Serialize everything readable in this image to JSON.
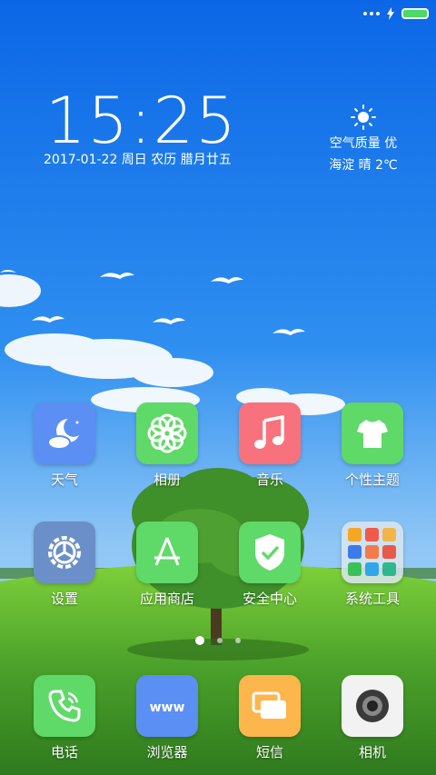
{
  "status_bar": {
    "battery_level": 1.0,
    "battery_color": "#4cd964"
  },
  "lockscreen": {
    "time": "15:25",
    "date": "2017-01-22 周日 农历 腊月廿五",
    "weather": {
      "icon": "sun-icon",
      "air_quality": "空气质量 优",
      "location_condition": "海淀 晴 2℃"
    }
  },
  "apps_row1": [
    {
      "label": "天气",
      "icon": "weather-moon-cloud-icon",
      "color": "#5c8ff3"
    },
    {
      "label": "相册",
      "icon": "gallery-flower-icon",
      "color": "#5fd968"
    },
    {
      "label": "音乐",
      "icon": "music-note-icon",
      "color": "#f8727e"
    },
    {
      "label": "个性主题",
      "icon": "tshirt-icon",
      "color": "#5fd968"
    }
  ],
  "apps_row2": [
    {
      "label": "设置",
      "icon": "settings-gear-icon",
      "color": "#6b8fc8"
    },
    {
      "label": "应用商店",
      "icon": "app-store-icon",
      "color": "#5fd968"
    },
    {
      "label": "安全中心",
      "icon": "shield-check-icon",
      "color": "#5fd968"
    },
    {
      "label": "系统工具",
      "icon": "folder-icon",
      "color": "#c9d4dc"
    }
  ],
  "dock": [
    {
      "label": "电话",
      "icon": "phone-icon",
      "color": "#5fd968"
    },
    {
      "label": "浏览器",
      "icon": "browser-www-icon",
      "color": "#5c8ff3"
    },
    {
      "label": "短信",
      "icon": "messages-icon",
      "color": "#fdb64c"
    },
    {
      "label": "相机",
      "icon": "camera-icon",
      "color": "#f2f2f2"
    }
  ],
  "pager": {
    "pages": 3,
    "current": 1
  }
}
